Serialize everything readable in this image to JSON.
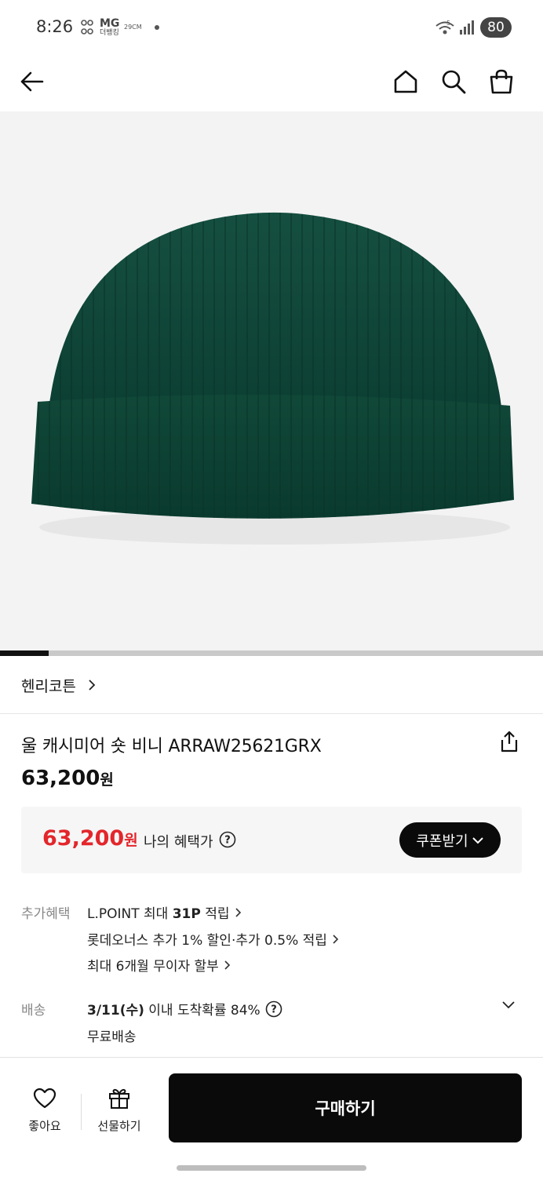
{
  "status_bar": {
    "time": "8:26",
    "mg_top": "MG",
    "mg_bottom": "더뱅킹",
    "cm": "29CM",
    "battery": "80"
  },
  "brand": {
    "name": "헨리코튼"
  },
  "product": {
    "title": "울 캐시미어 숏 비니 ARRAW25621GRX",
    "price": "63,200",
    "price_unit": "원",
    "image_progress": 0.09
  },
  "benefit": {
    "price": "63,200",
    "price_unit": "원",
    "label": "나의 혜택가",
    "coupon_button": "쿠폰받기"
  },
  "extra_benefits": {
    "label": "추가혜택",
    "lines": [
      {
        "pre": "L.POINT 최대 ",
        "bold": "31P",
        "post": " 적립"
      },
      {
        "pre": "롯데오너스 추가 1% 할인·추가 0.5% 적립",
        "bold": "",
        "post": ""
      },
      {
        "pre": "최대 6개월 무이자 할부",
        "bold": "",
        "post": ""
      }
    ]
  },
  "delivery": {
    "label": "배송",
    "date": "3/11(수)",
    "text": " 이내 도착확률 84%",
    "free": "무료배송"
  },
  "bottom": {
    "like_label": "좋아요",
    "gift_label": "선물하기",
    "buy_label": "구매하기"
  },
  "colors": {
    "accent_red": "#e3262b",
    "button_black": "#0a0a0a",
    "beanie_green": "#0f4a3a"
  }
}
